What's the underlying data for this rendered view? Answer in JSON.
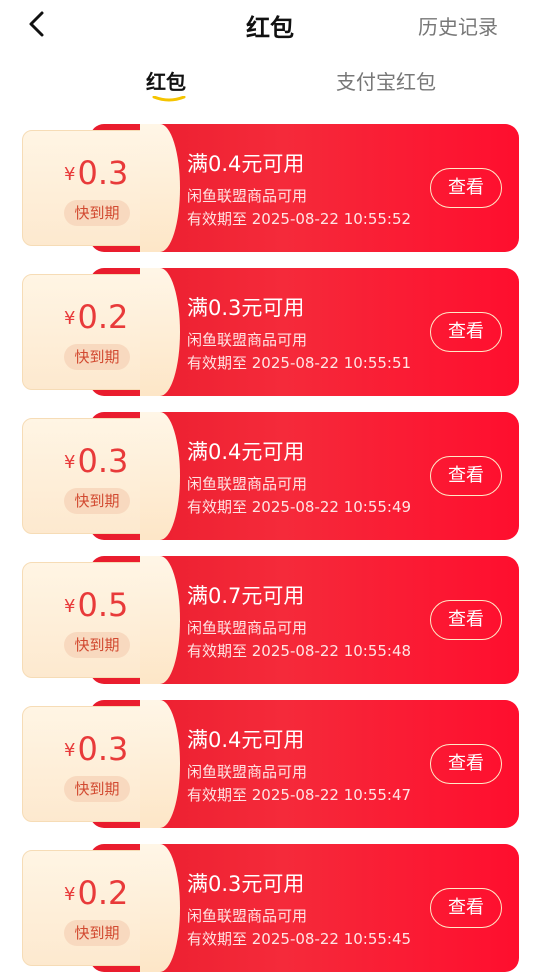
{
  "header": {
    "title": "红包",
    "history_label": "历史记录",
    "back_icon": "chevron-left-icon"
  },
  "tabs": [
    {
      "label": "红包",
      "active": true
    },
    {
      "label": "支付宝红包",
      "active": false
    }
  ],
  "colors": {
    "accent": "#ff1a33",
    "tab_underline": "#f5c400",
    "amount_text": "#e83a3a"
  },
  "coupons": [
    {
      "currency": "¥",
      "amount": "0.3",
      "badge": "快到期",
      "condition": "满0.4元可用",
      "scope": "闲鱼联盟商品可用",
      "expiry": "有效期至 2025-08-22 10:55:52",
      "button": "查看"
    },
    {
      "currency": "¥",
      "amount": "0.2",
      "badge": "快到期",
      "condition": "满0.3元可用",
      "scope": "闲鱼联盟商品可用",
      "expiry": "有效期至 2025-08-22 10:55:51",
      "button": "查看"
    },
    {
      "currency": "¥",
      "amount": "0.3",
      "badge": "快到期",
      "condition": "满0.4元可用",
      "scope": "闲鱼联盟商品可用",
      "expiry": "有效期至 2025-08-22 10:55:49",
      "button": "查看"
    },
    {
      "currency": "¥",
      "amount": "0.5",
      "badge": "快到期",
      "condition": "满0.7元可用",
      "scope": "闲鱼联盟商品可用",
      "expiry": "有效期至 2025-08-22 10:55:48",
      "button": "查看"
    },
    {
      "currency": "¥",
      "amount": "0.3",
      "badge": "快到期",
      "condition": "满0.4元可用",
      "scope": "闲鱼联盟商品可用",
      "expiry": "有效期至 2025-08-22 10:55:47",
      "button": "查看"
    },
    {
      "currency": "¥",
      "amount": "0.2",
      "badge": "快到期",
      "condition": "满0.3元可用",
      "scope": "闲鱼联盟商品可用",
      "expiry": "有效期至 2025-08-22 10:55:45",
      "button": "查看"
    }
  ]
}
